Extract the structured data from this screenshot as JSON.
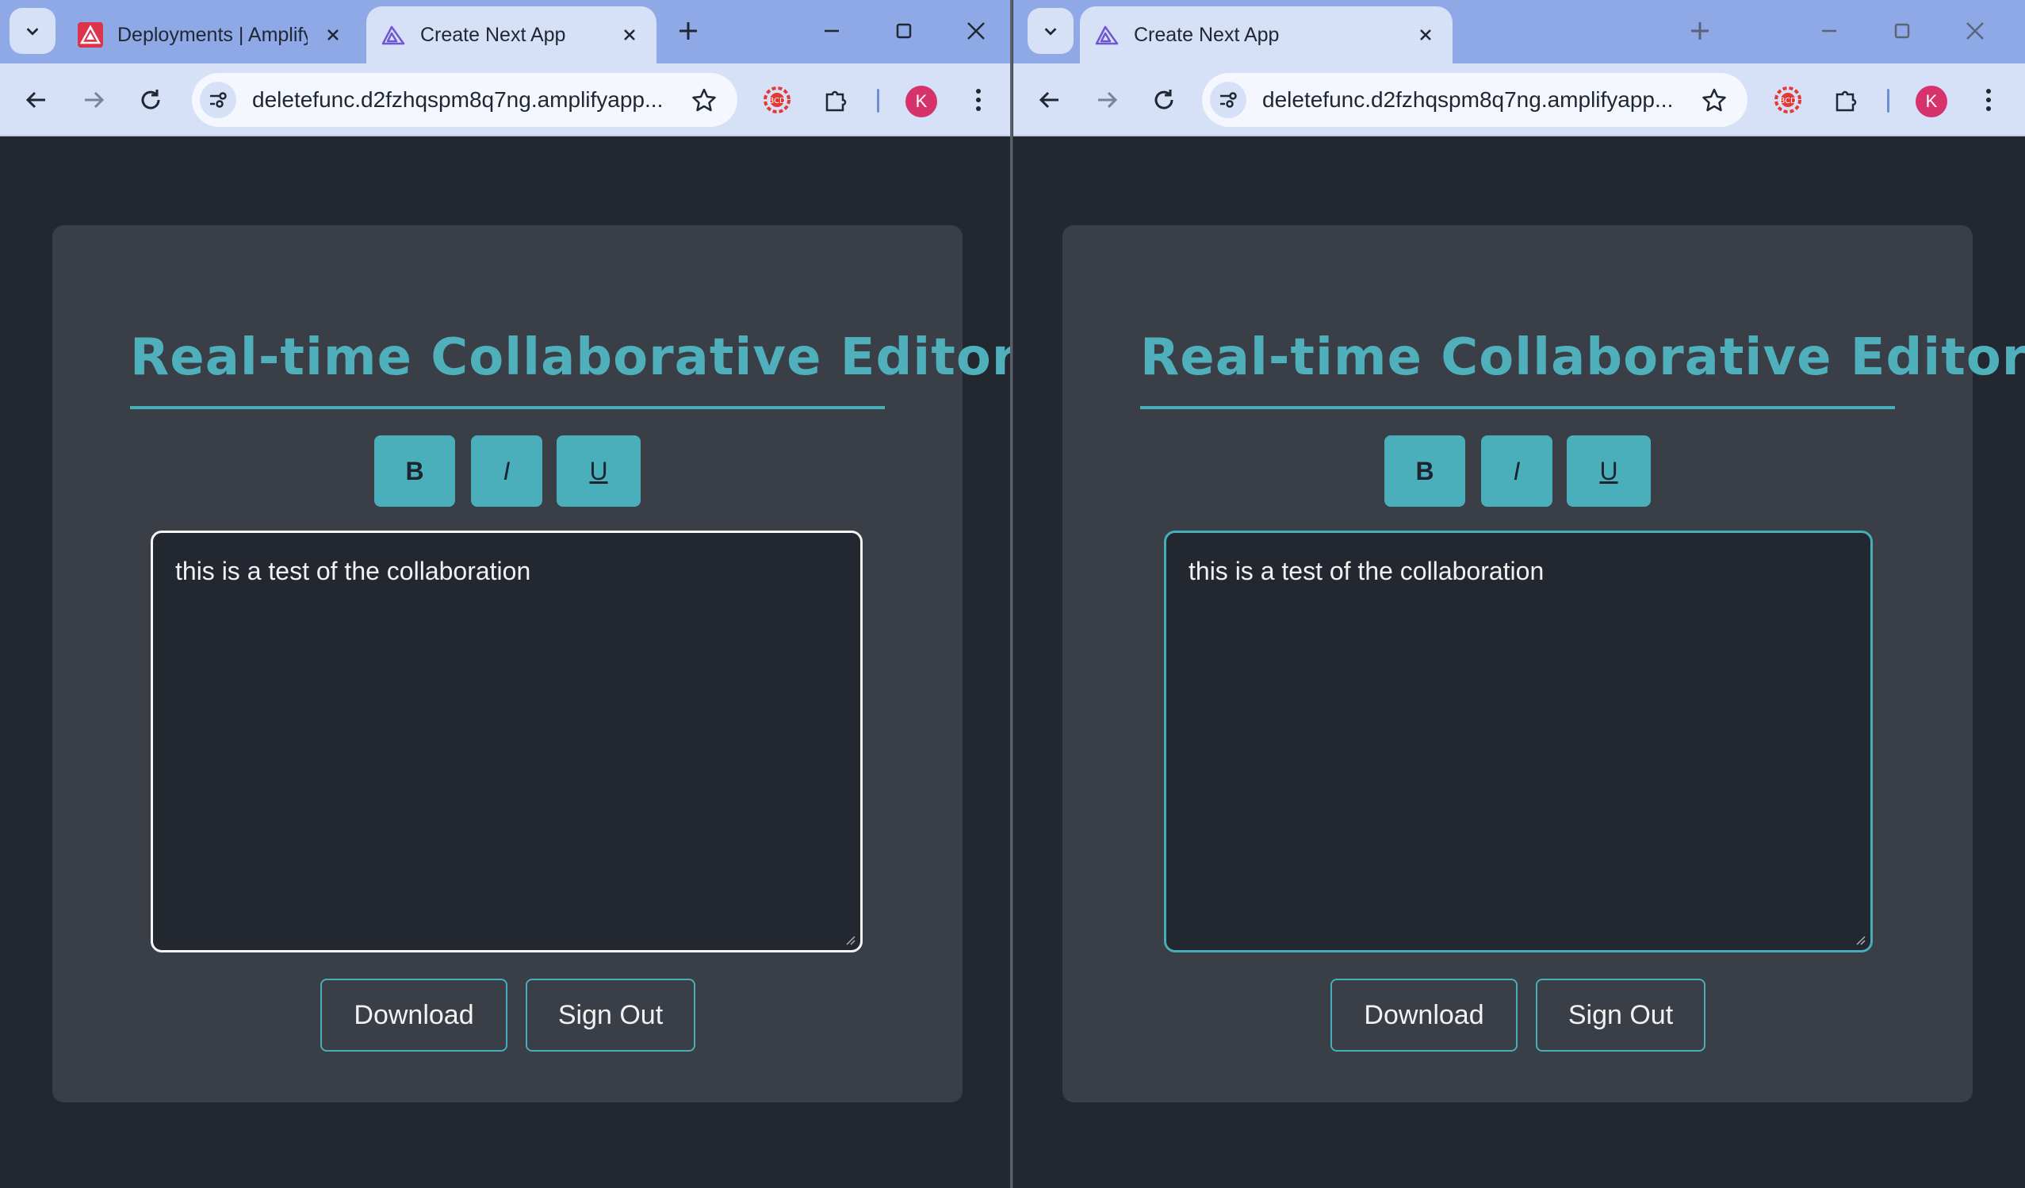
{
  "windows": [
    {
      "id": "left",
      "tabs": [
        {
          "label": "Deployments | Amplify",
          "favicon": "aws-amplify-icon",
          "active": false
        },
        {
          "label": "Create Next App",
          "favicon": "amplify-a-icon",
          "active": true
        }
      ],
      "url": "deletefunc.d2fzhqspm8q7ng.amplifyapp....",
      "avatar_letter": "K",
      "page": {
        "heading": "Real-time Collaborative Editor",
        "format_buttons": {
          "bold": "B",
          "italic": "I",
          "underline": "U"
        },
        "editor_text": "this is a test of the collaboration",
        "download_label": "Download",
        "signout_label": "Sign Out"
      }
    },
    {
      "id": "right",
      "tabs": [
        {
          "label": "Create Next App",
          "favicon": "amplify-a-icon",
          "active": true
        }
      ],
      "url": "deletefunc.d2fzhqspm8q7ng.amplifyapp....",
      "avatar_letter": "K",
      "page": {
        "heading": "Real-time Collaborative Editor",
        "format_buttons": {
          "bold": "B",
          "italic": "I",
          "underline": "U"
        },
        "editor_text": "this is a test of the collaboration",
        "download_label": "Download",
        "signout_label": "Sign Out"
      }
    }
  ],
  "colors": {
    "page_bg": "#23272f",
    "card_bg": "#393e47",
    "accent": "#4aafba",
    "tabstrip": "#8fa9e6",
    "toolbar": "#d6e0f7",
    "avatar": "#d6336c"
  }
}
